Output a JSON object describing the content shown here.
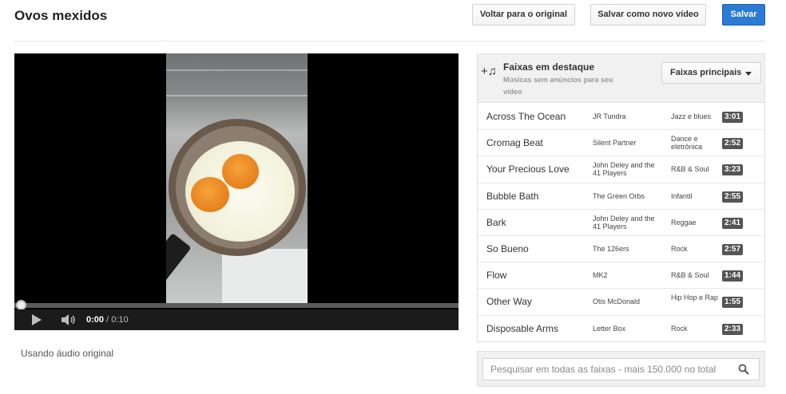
{
  "page": {
    "title": "Ovos mexidos"
  },
  "toolbar": {
    "revert_label": "Voltar para o original",
    "save_as_label": "Salvar como novo vídeo",
    "save_label": "Salvar"
  },
  "player": {
    "current_time": "0:00",
    "duration": "/ 0:10",
    "progress_fraction": 0,
    "accent": "#cc181e"
  },
  "audio_note": "Usando áudio original",
  "tracks_panel": {
    "title": "Faixas em destaque",
    "subtitle": "Músicas sem anúncios para seu vídeo",
    "filter_label": "Faixas principais",
    "icon": "music-note-add-icon",
    "tracks": [
      {
        "name": "Across The Ocean",
        "artist": "JR Tundra",
        "genre": "Jazz e blues",
        "duration": "3:01"
      },
      {
        "name": "Cromag Beat",
        "artist": "Silent Partner",
        "genre": "Dance e eletrônica",
        "duration": "2:52"
      },
      {
        "name": "Your Precious Love",
        "artist": "John Deley and the 41 Players",
        "genre": "R&B & Soul",
        "duration": "3:23"
      },
      {
        "name": "Bubble Bath",
        "artist": "The Green Orbs",
        "genre": "Infantil",
        "duration": "2:55"
      },
      {
        "name": "Bark",
        "artist": "John Deley and the 41 Players",
        "genre": "Reggae",
        "duration": "2:41"
      },
      {
        "name": "So Bueno",
        "artist": "The 126ers",
        "genre": "Rock",
        "duration": "2:57"
      },
      {
        "name": "Flow",
        "artist": "MK2",
        "genre": "R&B & Soul",
        "duration": "1:44"
      },
      {
        "name": "Other Way",
        "artist": "Otis McDonald",
        "genre": "Hip Hop e Rap",
        "duration": "1:55"
      },
      {
        "name": "Disposable Arms",
        "artist": "Letter Box",
        "genre": "Rock",
        "duration": "2:33"
      }
    ]
  },
  "search": {
    "placeholder": "Pesquisar em todas as faixas - mais 150.000 no total",
    "value": ""
  },
  "colors": {
    "primary_button": "#2b7ad4"
  }
}
